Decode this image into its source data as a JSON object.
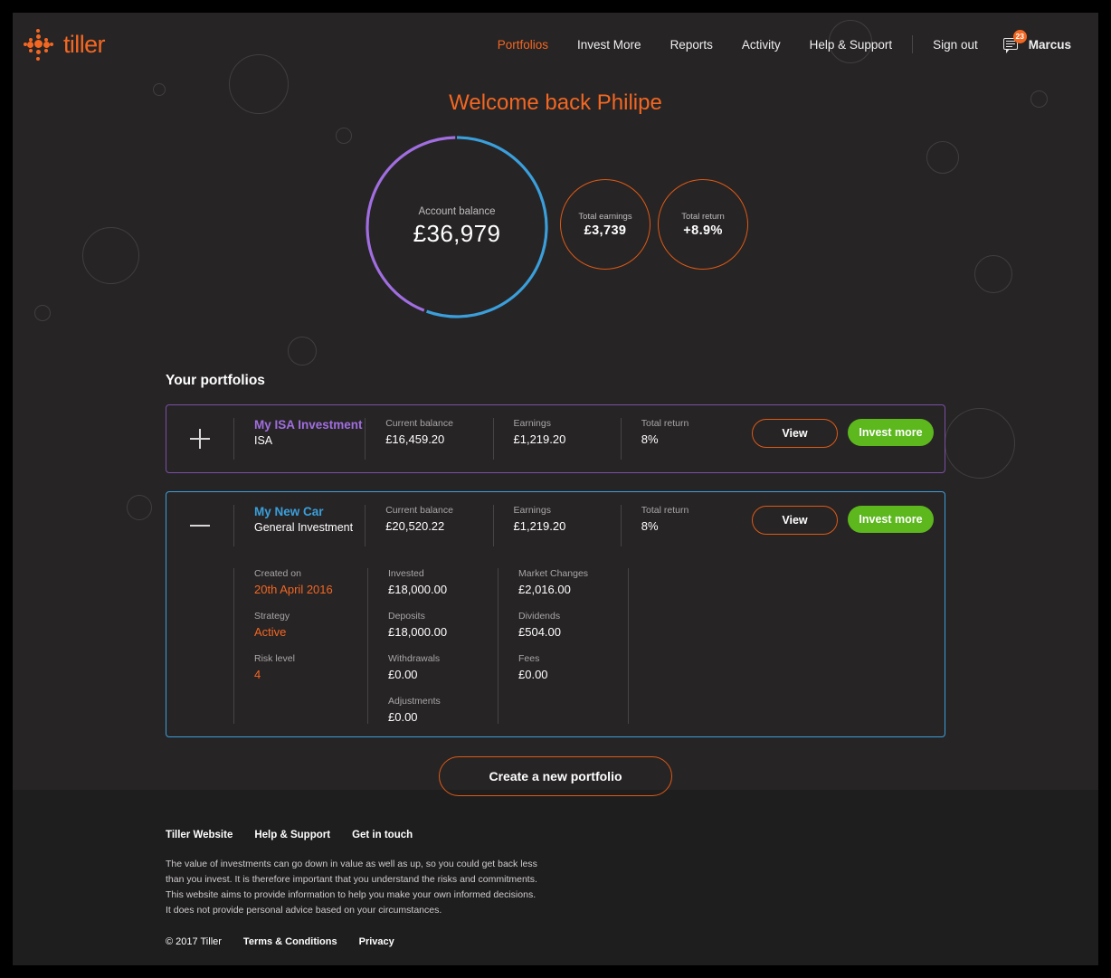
{
  "brand": {
    "name": "tiller",
    "color": "#f26722"
  },
  "nav": {
    "items": [
      {
        "label": "Portfolios",
        "active": true
      },
      {
        "label": "Invest More",
        "active": false
      },
      {
        "label": "Reports",
        "active": false
      },
      {
        "label": "Activity",
        "active": false
      },
      {
        "label": "Help & Support",
        "active": false
      }
    ],
    "sign_out": "Sign out",
    "messages_badge": "23",
    "username": "Marcus"
  },
  "hero": {
    "welcome": "Welcome back Philipe",
    "balance": {
      "label": "Account balance",
      "value": "£36,979"
    },
    "earnings": {
      "label": "Total earnings",
      "value": "£3,739"
    },
    "return": {
      "label": "Total return",
      "value": "+8.9%"
    }
  },
  "chart_data": {
    "type": "pie",
    "title": "Account balance",
    "categories": [
      "My New Car",
      "My ISA Investment"
    ],
    "values": [
      20520.22,
      16459.2
    ],
    "colors": [
      "#3a9fdb",
      "#a06ee0"
    ],
    "total": 36979.42,
    "center_label": "Account balance",
    "center_value": "£36,979"
  },
  "portfolios": {
    "heading": "Your portfolios",
    "buttons": {
      "view": "View",
      "invest": "Invest more"
    },
    "labels": {
      "current_balance": "Current balance",
      "earnings": "Earnings",
      "total_return": "Total return",
      "created_on": "Created on",
      "invested": "Invested",
      "market_changes": "Market Changes",
      "strategy": "Strategy",
      "deposits": "Deposits",
      "dividends": "Dividends",
      "risk_level": "Risk level",
      "withdrawals": "Withdrawals",
      "fees": "Fees",
      "adjustments": "Adjustments"
    },
    "items": [
      {
        "name": "My ISA Investment",
        "type": "ISA",
        "current_balance": "£16,459.20",
        "earnings": "£1,219.20",
        "total_return": "8%",
        "expanded": false,
        "toggle_icon": "plus-icon"
      },
      {
        "name": "My New Car",
        "type": "General Investment",
        "current_balance": "£20,520.22",
        "earnings": "£1,219.20",
        "total_return": "8%",
        "expanded": true,
        "toggle_icon": "minus-icon",
        "created_on": "20th April 2016",
        "invested": "£18,000.00",
        "market_changes": "£2,016.00",
        "strategy": "Active",
        "deposits": "£18,000.00",
        "dividends": "£504.00",
        "risk_level": "4",
        "withdrawals": "£0.00",
        "fees": "£0.00",
        "adjustments": "£0.00"
      }
    ],
    "create_button": "Create a new portfolio"
  },
  "footer": {
    "links": [
      "Tiller Website",
      "Help & Support",
      "Get in touch"
    ],
    "disclaimer": "The value of investments can go down in value as well as up, so you could get back less than you invest. It is therefore important that you understand the risks and commitments. This website aims to provide information to help you make your own informed decisions. It does not provide personal advice based on your circumstances.",
    "copyright": "© 2017 Tiller",
    "bottom_links": [
      "Terms & Conditions",
      "Privacy"
    ]
  }
}
